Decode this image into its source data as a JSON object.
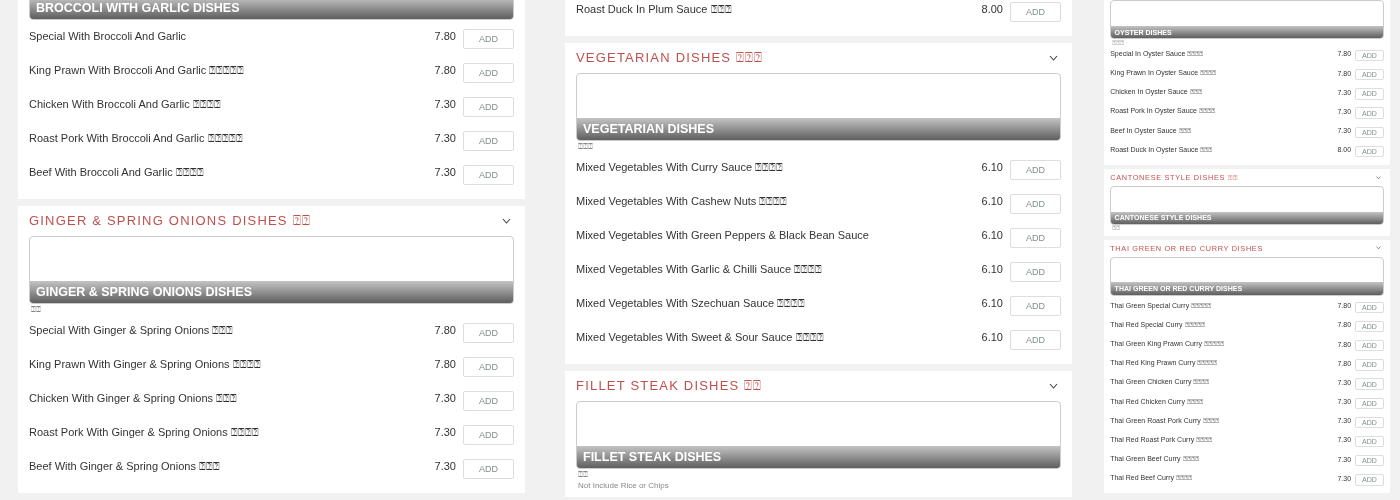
{
  "columns": [
    {
      "sections": [
        {
          "banner": "BROCCOLI WITH GARLIC DISHES",
          "items": [
            {
              "name": "Special With Broccoli And Garlic",
              "price": "7.80",
              "button": "ADD"
            },
            {
              "name": "King Prawn With Broccoli And Garlic ⍰⍰⍰⍰⍰",
              "price": "7.80",
              "button": "ADD"
            },
            {
              "name": "Chicken With Broccoli And Garlic ⍰⍰⍰⍰",
              "price": "7.30",
              "button": "ADD"
            },
            {
              "name": "Roast Pork With Broccoli And Garlic ⍰⍰⍰⍰⍰",
              "price": "7.30",
              "button": "ADD"
            },
            {
              "name": "Beef With Broccoli And Garlic ⍰⍰⍰⍰",
              "price": "7.30",
              "button": "ADD"
            }
          ]
        },
        {
          "title": "GINGER & SPRING ONIONS DISHES ⍰⍰",
          "banner": "GINGER & SPRING ONIONS DISHES",
          "note": "⍰⍰",
          "items": [
            {
              "name": "Special With Ginger & Spring Onions ⍰⍰⍰",
              "price": "7.80",
              "button": "ADD"
            },
            {
              "name": "King Prawn With Ginger & Spring Onions ⍰⍰⍰⍰",
              "price": "7.80",
              "button": "ADD"
            },
            {
              "name": "Chicken With Ginger & Spring Onions ⍰⍰⍰",
              "price": "7.30",
              "button": "ADD"
            },
            {
              "name": "Roast Pork With Ginger & Spring Onions ⍰⍰⍰⍰",
              "price": "7.30",
              "button": "ADD"
            },
            {
              "name": "Beef With Ginger & Spring Onions ⍰⍰⍰",
              "price": "7.30",
              "button": "ADD"
            }
          ]
        }
      ]
    },
    {
      "sections": [
        {
          "items": [
            {
              "name": "Roast Duck In Plum Sauce ⍰⍰⍰",
              "price": "8.00",
              "button": "ADD"
            }
          ]
        },
        {
          "title": "VEGETARIAN DISHES ⍰⍰⍰",
          "banner": "VEGETARIAN DISHES",
          "note": "⍰⍰⍰",
          "items": [
            {
              "name": "Mixed Vegetables With Curry Sauce ⍰⍰⍰⍰",
              "price": "6.10",
              "button": "ADD"
            },
            {
              "name": "Mixed Vegetables With Cashew Nuts ⍰⍰⍰⍰",
              "price": "6.10",
              "button": "ADD"
            },
            {
              "name": "Mixed Vegetables With Green Peppers & Black Bean Sauce",
              "price": "6.10",
              "button": "ADD"
            },
            {
              "name": "Mixed Vegetables With Garlic & Chilli Sauce ⍰⍰⍰⍰",
              "price": "6.10",
              "button": "ADD"
            },
            {
              "name": "Mixed Vegetables With Szechuan Sauce ⍰⍰⍰⍰",
              "price": "6.10",
              "button": "ADD"
            },
            {
              "name": "Mixed Vegetables With Sweet & Sour Sauce ⍰⍰⍰⍰",
              "price": "6.10",
              "button": "ADD"
            }
          ]
        },
        {
          "title": "FILLET STEAK DISHES ⍰⍰",
          "banner": "FILLET STEAK DISHES",
          "note": "⍰⍰",
          "description": "Not Include Rice or Chips"
        }
      ]
    },
    {
      "sections": [
        {
          "banner": "OYSTER DISHES",
          "note": "⍰⍰⍰",
          "items": [
            {
              "name": "Special In Oyster Sauce ⍰⍰⍰⍰",
              "price": "7.80",
              "button": "ADD"
            },
            {
              "name": "King Prawn In Oyster Sauce ⍰⍰⍰⍰",
              "price": "7.80",
              "button": "ADD"
            },
            {
              "name": "Chicken In Oyster Sauce ⍰⍰⍰",
              "price": "7.30",
              "button": "ADD"
            },
            {
              "name": "Roast Pork In Oyster Sauce ⍰⍰⍰⍰",
              "price": "7.30",
              "button": "ADD"
            },
            {
              "name": "Beef In Oyster Sauce ⍰⍰⍰",
              "price": "7.30",
              "button": "ADD"
            },
            {
              "name": "Roast Duck In Oyster Sauce ⍰⍰⍰",
              "price": "8.00",
              "button": "ADD"
            }
          ]
        },
        {
          "title": "CANTONESE STYLE DISHES ⍰⍰",
          "banner": "CANTONESE STYLE DISHES",
          "note": "⍰⍰"
        },
        {
          "title": "THAI GREEN OR RED CURRY DISHES",
          "banner": "THAI GREEN OR RED CURRY DISHES",
          "items": [
            {
              "name": "Thai Green Special Curry ⍰⍰⍰⍰⍰",
              "price": "7.80",
              "button": "ADD"
            },
            {
              "name": "Thai Red Special Curry ⍰⍰⍰⍰⍰",
              "price": "7.80",
              "button": "ADD"
            },
            {
              "name": "Thai Green King Prawn Curry ⍰⍰⍰⍰⍰",
              "price": "7.80",
              "button": "ADD"
            },
            {
              "name": "Thai Red King Prawn Curry ⍰⍰⍰⍰⍰",
              "price": "7.80",
              "button": "ADD"
            },
            {
              "name": "Thai Green Chicken Curry ⍰⍰⍰⍰",
              "price": "7.30",
              "button": "ADD"
            },
            {
              "name": "Thai Red Chicken Curry ⍰⍰⍰⍰",
              "price": "7.30",
              "button": "ADD"
            },
            {
              "name": "Thai Green Roast Pork Curry ⍰⍰⍰⍰",
              "price": "7.30",
              "button": "ADD"
            },
            {
              "name": "Thai Red Roast Pork Curry ⍰⍰⍰⍰",
              "price": "7.30",
              "button": "ADD"
            },
            {
              "name": "Thai Green Beef Curry ⍰⍰⍰⍰",
              "price": "7.30",
              "button": "ADD"
            },
            {
              "name": "Thai Red Beef Curry ⍰⍰⍰⍰",
              "price": "7.30",
              "button": "ADD"
            }
          ]
        }
      ]
    }
  ]
}
